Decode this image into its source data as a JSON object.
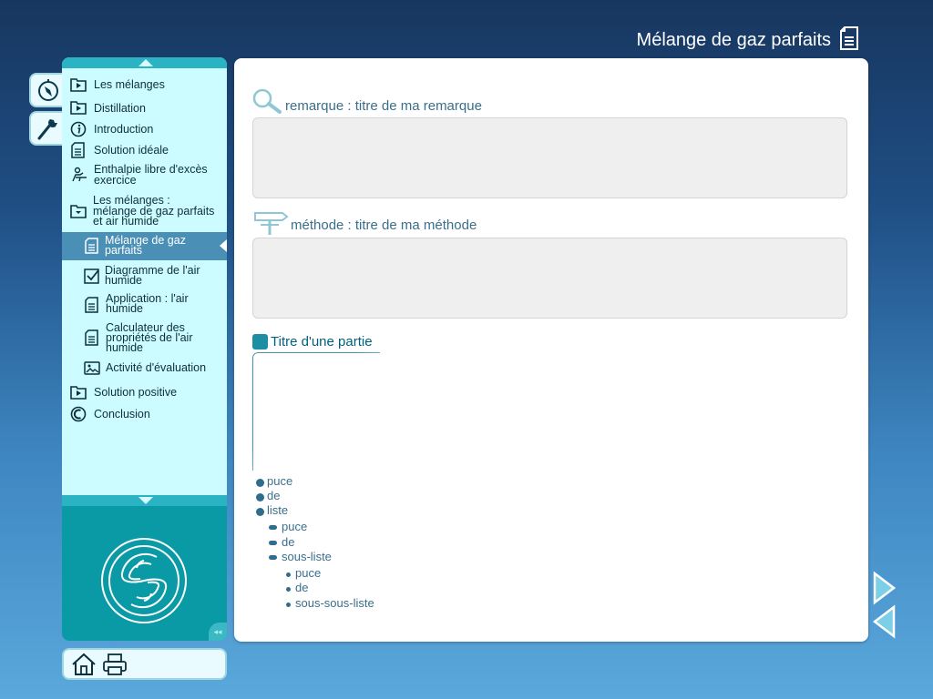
{
  "header": {
    "title": "Mélange de gaz parfaits",
    "title_icon": "document-icon"
  },
  "side_tabs": [
    {
      "name": "compass",
      "icon": "compass-icon"
    },
    {
      "name": "tools",
      "icon": "wrench-icon"
    }
  ],
  "toc": {
    "items": [
      {
        "label_lines": [
          "Les mélanges"
        ],
        "icon": "play-folder-icon"
      },
      {
        "label_lines": [
          "Distillation"
        ],
        "icon": "play-folder-icon"
      },
      {
        "label_lines": [
          "Introduction"
        ],
        "icon": "info-icon"
      },
      {
        "label_lines": [
          "Solution idéale"
        ],
        "icon": "document-icon"
      },
      {
        "label_lines": [
          "Enthalpie libre d'excès",
          "exercice"
        ],
        "icon": "exercise-icon"
      },
      {
        "label_lines": [
          "Les mélanges :",
          "mélange de gaz parfaits",
          "et air humide"
        ],
        "icon": "open-folder-icon"
      },
      {
        "label_lines": [
          "Mélange de gaz",
          "parfaits"
        ],
        "icon": "document-icon",
        "selected": true
      },
      {
        "label_lines": [
          "Diagramme de l'air",
          "humide"
        ],
        "icon": "checkbox-icon"
      },
      {
        "label_lines": [
          "Application  : l'air",
          "humide"
        ],
        "icon": "document-icon"
      },
      {
        "label_lines": [
          "Calculateur des",
          "propriétés de l'air",
          "humide"
        ],
        "icon": "document-icon"
      },
      {
        "label_lines": [
          "Activité d'évaluation"
        ],
        "icon": "evaluation-icon"
      },
      {
        "label_lines": [
          "Solution positive"
        ],
        "icon": "play-folder-icon"
      },
      {
        "label_lines": [
          "Conclusion"
        ],
        "icon": "back-circle-icon"
      }
    ]
  },
  "logo": {
    "icon": "logo-icon"
  },
  "tools": {
    "home_icon": "home-icon",
    "print_icon": "print-icon"
  },
  "content": {
    "remark": {
      "title": "remarque : titre de ma remarque",
      "icon": "magnifier-icon"
    },
    "method": {
      "title": "méthode : titre de ma méthode",
      "icon": "signpost-icon"
    },
    "part": {
      "title": "Titre d'une partie"
    },
    "list": {
      "level1": [
        "puce",
        "de",
        "liste"
      ],
      "level2": [
        "puce",
        "de",
        "sous-liste"
      ],
      "level3": [
        "puce",
        "de",
        "sous-sous-liste"
      ]
    }
  },
  "nav": {
    "next_icon": "next-arrow-icon",
    "prev_icon": "prev-arrow-icon"
  },
  "colors": {
    "accent": "#0a9aa6",
    "toc_bg": "#ccfcff",
    "selected": "#4a8fb6",
    "text_blue": "#3a6f8c"
  }
}
